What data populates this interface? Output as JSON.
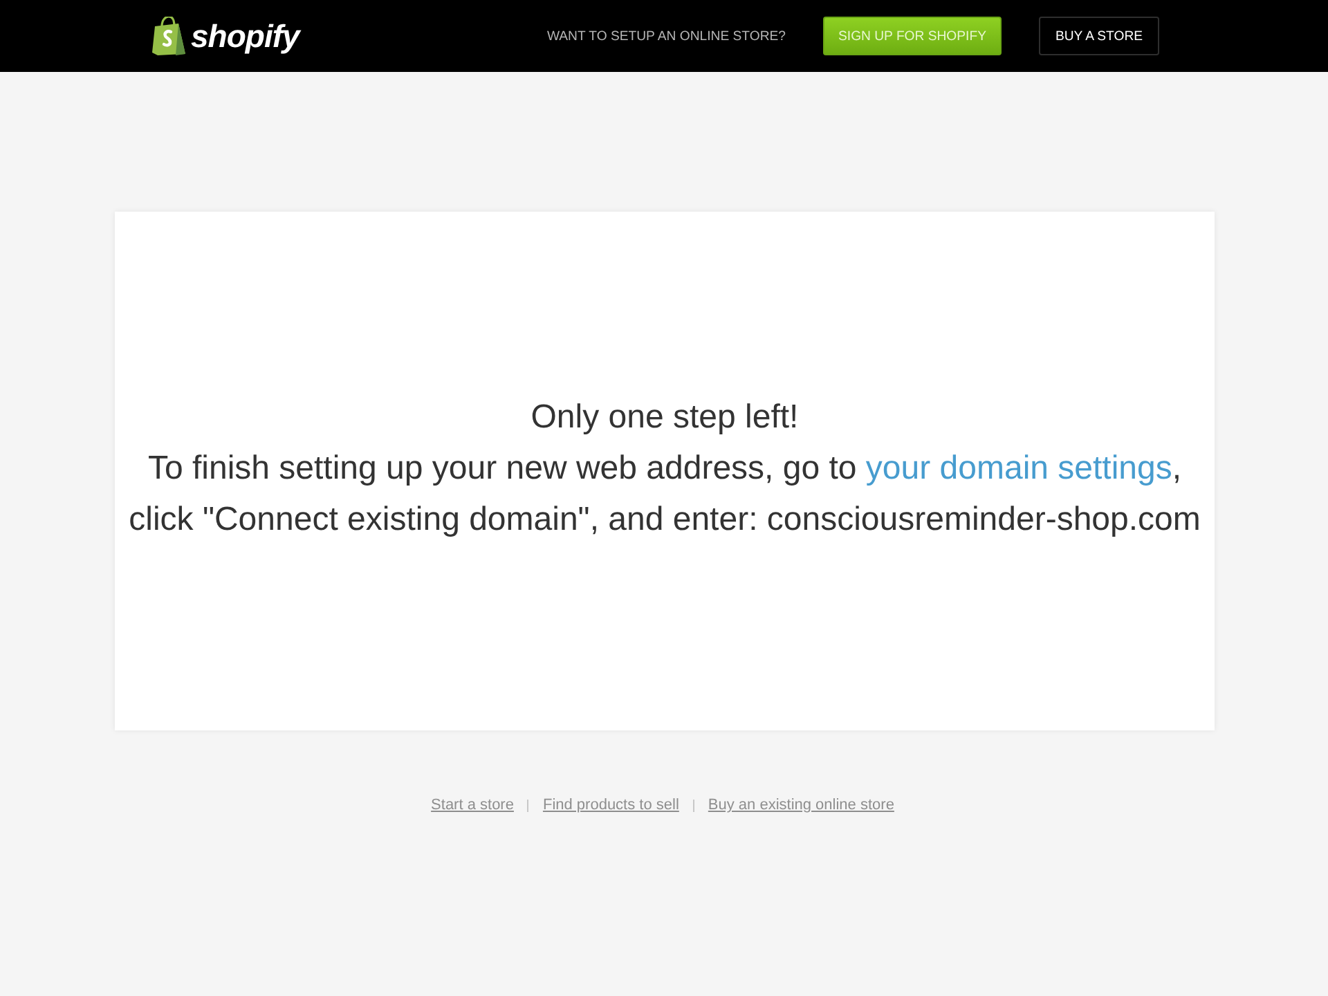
{
  "header": {
    "logo_text": "shopify",
    "prompt": "WANT TO SETUP AN ONLINE STORE?",
    "buttons": [
      {
        "kind": "primary",
        "label": "SIGN UP FOR SHOPIFY"
      },
      {
        "kind": "outline",
        "label": "BUY A STORE"
      }
    ]
  },
  "message": {
    "heading": "Only one step left!",
    "before_link": "To finish setting up your new web address, go to ",
    "link": "your domain settings",
    "after_link": ", click \"Connect existing domain\", and enter: consciousreminder-shop.com"
  },
  "footer": {
    "links": [
      "Start a store",
      "Find products to sell",
      "Buy an existing online store"
    ]
  }
}
